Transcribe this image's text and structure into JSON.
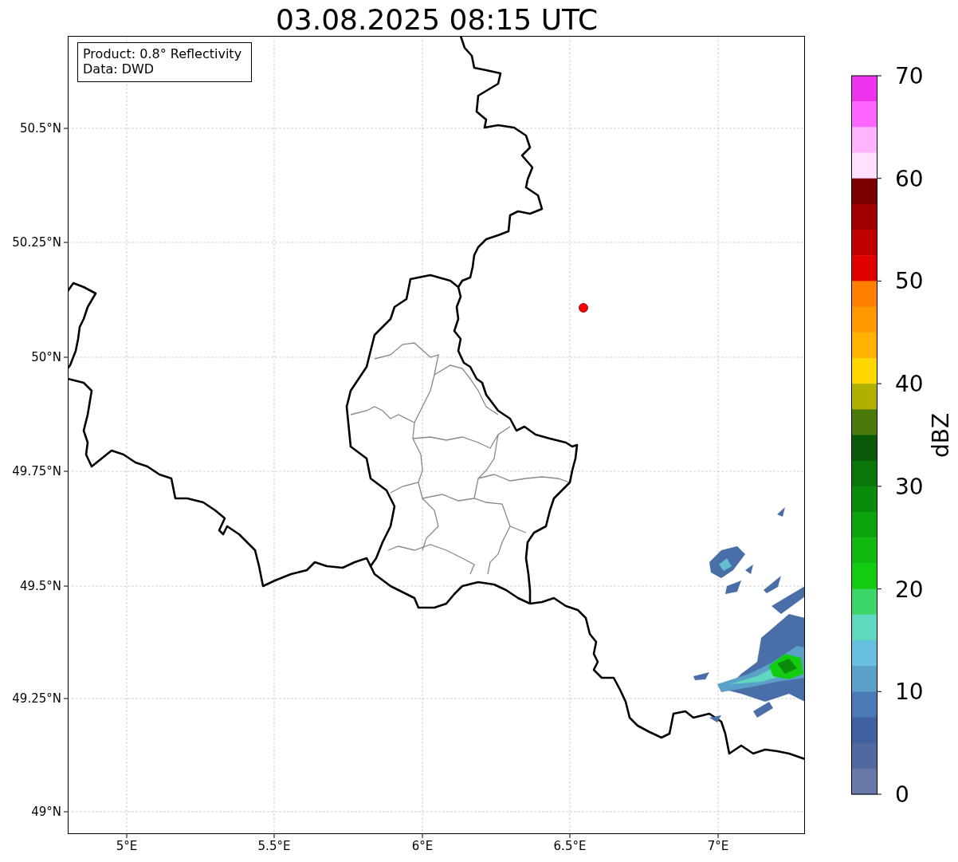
{
  "title": "03.08.2025 08:15 UTC",
  "info_box": {
    "lines": [
      "Product: 0.8° Reflectivity",
      "Data: DWD"
    ]
  },
  "map": {
    "x_ticks": [
      "5°E",
      "5.5°E",
      "6°E",
      "6.5°E",
      "7°E"
    ],
    "y_ticks": [
      "50.5°N",
      "50.25°N",
      "50°N",
      "49.75°N",
      "49.5°N",
      "49.25°N",
      "49°N"
    ]
  },
  "colorbar": {
    "label": "dBZ",
    "ticks": [
      "70",
      "60",
      "50",
      "40",
      "30",
      "20",
      "10",
      "0"
    ],
    "bins": [
      {
        "color": "#ee33ee"
      },
      {
        "color": "#ff66ff"
      },
      {
        "color": "#ffb3ff"
      },
      {
        "color": "#ffe0ff"
      },
      {
        "color": "#7a0000"
      },
      {
        "color": "#a00000"
      },
      {
        "color": "#c00000"
      },
      {
        "color": "#e00000"
      },
      {
        "color": "#ff7f00"
      },
      {
        "color": "#ff9900"
      },
      {
        "color": "#ffb300"
      },
      {
        "color": "#ffd700"
      },
      {
        "color": "#b0b000"
      },
      {
        "color": "#4a7a0a"
      },
      {
        "color": "#0a5a0a"
      },
      {
        "color": "#0a760a"
      },
      {
        "color": "#0a8c0a"
      },
      {
        "color": "#0ca40c"
      },
      {
        "color": "#10b810"
      },
      {
        "color": "#12cc12"
      },
      {
        "color": "#3dd66a"
      },
      {
        "color": "#60d8c0"
      },
      {
        "color": "#66c0dd"
      },
      {
        "color": "#5aa0c8"
      },
      {
        "color": "#4a7ab5"
      },
      {
        "color": "#4060a0"
      },
      {
        "color": "#5268a0"
      },
      {
        "color": "#6878a8"
      }
    ]
  }
}
